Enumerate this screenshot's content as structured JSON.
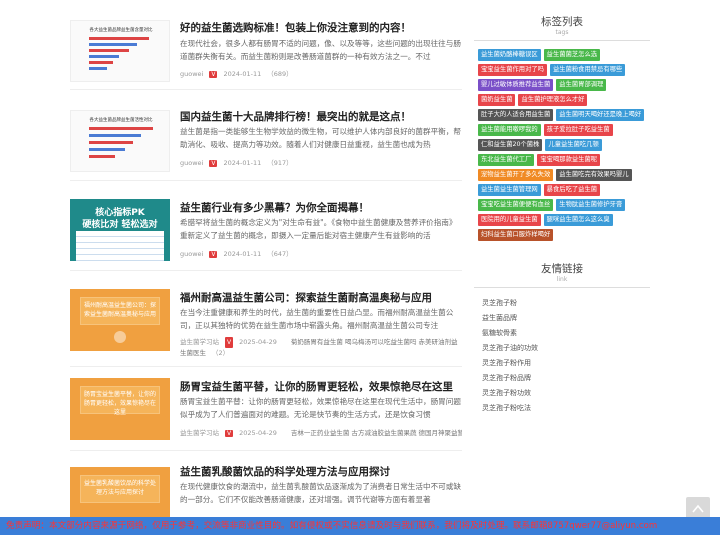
{
  "articles": [
    {
      "title": "好的益生菌选购标准！包装上你没注意到的内容！",
      "desc": "在现代社会，很多人都有肠胃不适的问题，像、以及等等，这些问题的出现往往与肠道菌群失衡有关。而益生菌粉则是改善肠道菌群的一种有效方法之一。不过",
      "author": "guowei",
      "badge": "V",
      "date": "2024-01-11",
      "views": "（689）",
      "thumb_title": "各大益生菌品牌益生菌含量对比"
    },
    {
      "title": "国内益生菌十大品牌排行榜！最突出的就是这点！",
      "desc": "益生菌是指一类能够生生物学效益的微生物，可以维护人体内部良好的菌群平衡，帮助消化、吸收、提高力等功效。随着人们对健康日益重视，益生菌也成为热",
      "author": "guowei",
      "badge": "V",
      "date": "2024-01-11",
      "views": "（917）",
      "thumb_title": "各大益生菌品牌益生菌活性对比"
    },
    {
      "title": "益生菌行业有多少黑幕？为你全面揭幕！",
      "desc": "希腊罕将益生菌的概念定义为\"对生命有益\"。《食物中益生菌健康及营养评价指南》重新定义了益生菌的概念，即摄入一定量后能对宿主健康产生有益影响的活",
      "author": "guowei",
      "badge": "V",
      "date": "2024-01-11",
      "views": "（647）",
      "thumb_l1": "核心指标PK",
      "thumb_l2": "硬核比对 轻松选对"
    },
    {
      "title": "福州耐高温益生菌公司：探索益生菌耐高温奥秘与应用",
      "desc": "在当今注重健康和养生的时代，益生菌的重要性日益凸显。而福州耐高温益生菌公司，正以其独特的优势在益生菌市场中崭露头角。福州耐高温益生菌公司专注",
      "author": "益生菌学习站",
      "badge": "V",
      "date": "2025-04-29",
      "tags": "菊奶肠胃有益生菌  喝乌梅汤可以吃益生菌吗  赤美研油剂益生菌医生",
      "views": "（2）",
      "thumb_text": "福州耐高温益生菌公司：探索益生菌耐高温奥秘与应用"
    },
    {
      "title": "肠胃宝益生菌平替，让你的肠胃更轻松，效果惊艳尽在这里",
      "desc": "肠胃宝益生菌平替：让你的肠胃更轻松，效果惊艳尽在这里在现代生活中，肠胃问题似乎成为了人们普遍面对的难题。无论是快节奏的生活方式，还是饮食习惯",
      "author": "益生菌学习站",
      "badge": "V",
      "date": "2025-04-29",
      "tags": "吉林一正药业益生菌  古方减油胶益生菌果蔬  德国月神聚益暂益生菌",
      "views": "",
      "thumb_text": "肠胃宝益生菌平替，让你的肠胃更轻松，效果惊艳尽在这里"
    },
    {
      "title": "益生菌乳酸菌饮品的科学处理方法与应用探讨",
      "desc": "在现代健康饮食的潮流中，益生菌乳酸菌饮品逐渐成为了消费者日常生活中不可或缺的一部分。它们不仅能改善肠道健康，还对增强。调节代谢等方面有着显著",
      "thumb_text": "益生菌乳酸菌饮品的科学处理方法与应用探讨"
    }
  ],
  "sidebar": {
    "tags_title": "标签列表",
    "tags_sub": "tags",
    "tags": [
      {
        "label": "益生菌奶酪棒糖误区",
        "color": "#3a9bd8"
      },
      {
        "label": "益生菌菌芝怎么选",
        "color": "#49b84a"
      },
      {
        "label": "宝宝益生菌作用对了吗",
        "color": "#e8454a"
      },
      {
        "label": "益生菌粉食用禁忌有哪些",
        "color": "#3a9bd8"
      },
      {
        "label": "婴儿过敏体质推荐益生菌",
        "color": "#7a4fc8"
      },
      {
        "label": "益生菌胃部调理",
        "color": "#49b84a"
      },
      {
        "label": "菌奶益生菌",
        "color": "#e8454a"
      },
      {
        "label": "益生菌护理液怎么才好",
        "color": "#e8454a"
      },
      {
        "label": "肚子大的人适合用益生菌",
        "color": "#555555"
      },
      {
        "label": "益生菌明天喝好还是晚上喝好",
        "color": "#3a9bd8"
      },
      {
        "label": "益生菌能用嗽啰我的",
        "color": "#49b84a"
      },
      {
        "label": "孩子爱拉肚子吃益生菌",
        "color": "#e8454a"
      },
      {
        "label": "仁和益生菌20个菌株",
        "color": "#555555"
      },
      {
        "label": "儿童益生菌吃几顿",
        "color": "#3a9bd8"
      },
      {
        "label": "东北益生菌代工厂",
        "color": "#49b84a"
      },
      {
        "label": "宝宝喝那款益生菌呢",
        "color": "#e8454a"
      },
      {
        "label": "宠物益生菌开了多久失效",
        "color": "#f08a24"
      },
      {
        "label": "益生菌吃完有效果吗婴儿",
        "color": "#555555"
      },
      {
        "label": "益生菌益生菌管理网",
        "color": "#3a9bd8"
      },
      {
        "label": "暴食后吃了益生菌",
        "color": "#e8454a"
      },
      {
        "label": "宝宝吃益生菌便便有血丝",
        "color": "#49b84a"
      },
      {
        "label": "生物肽益生菌修护牙膏",
        "color": "#3a9bd8"
      },
      {
        "label": "医院用的儿童益生菌",
        "color": "#e8454a"
      },
      {
        "label": "腿咪益生菌怎么这么臭",
        "color": "#3a9bd8"
      },
      {
        "label": "妇科益生菌口服炸样喝好",
        "color": "#b8522a"
      }
    ],
    "links_title": "友情链接",
    "links_sub": "link",
    "links": [
      "灵芝孢子粉",
      "益生菌品牌",
      "氨糖软骨素",
      "灵芝孢子油的功效",
      "灵芝孢子粉作用",
      "灵芝孢子粉品牌",
      "灵芝孢子粉功效",
      "灵芝孢子粉吃法"
    ]
  },
  "footer": {
    "notice": "免责声明：本文部分内容来源于网络，仅用于参考，交流等非商业性目的。如有侵权或不实信息请及时与我们联系，我们将及时处理。联系邮箱8757qwer77@aliyun.com"
  },
  "colors": {
    "footer_bg": "#3a7ed8",
    "footer_text": "#ff3333",
    "badge": "#e03c3c"
  }
}
